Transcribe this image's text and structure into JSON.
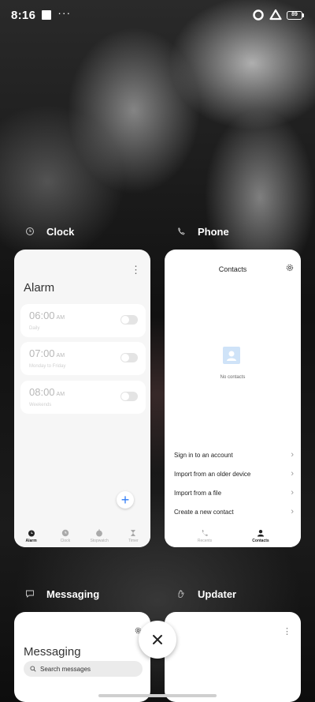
{
  "status_bar": {
    "time": "8:16",
    "more": "···",
    "battery": "89"
  },
  "apps": {
    "clock": {
      "name": "Clock",
      "menu": "⋮",
      "title": "Alarm",
      "alarms": [
        {
          "time": "06:00",
          "ampm": "AM",
          "sub": "Daily",
          "enabled": false
        },
        {
          "time": "07:00",
          "ampm": "AM",
          "sub": "Monday to Friday",
          "enabled": false
        },
        {
          "time": "08:00",
          "ampm": "AM",
          "sub": "Weekends",
          "enabled": false
        }
      ],
      "add": "+",
      "tabs": [
        "Alarm",
        "Clock",
        "Stopwatch",
        "Timer"
      ],
      "active_tab": "Alarm"
    },
    "phone": {
      "name": "Phone",
      "title": "Contacts",
      "empty": "No contacts",
      "options": [
        "Sign in to an account",
        "Import from an older device",
        "Import from a file",
        "Create a new contact"
      ],
      "chevron": "›",
      "tabs": [
        "Recents",
        "Contacts"
      ],
      "active_tab": "Contacts"
    },
    "messaging": {
      "name": "Messaging",
      "title": "Messaging",
      "search_placeholder": "Search messages"
    },
    "updater": {
      "name": "Updater",
      "menu": "⋮"
    }
  },
  "colors": {
    "accent": "#2f7cf6",
    "card_bg": "#f6f6f6",
    "avatar_bg": "#cfe3f8"
  }
}
